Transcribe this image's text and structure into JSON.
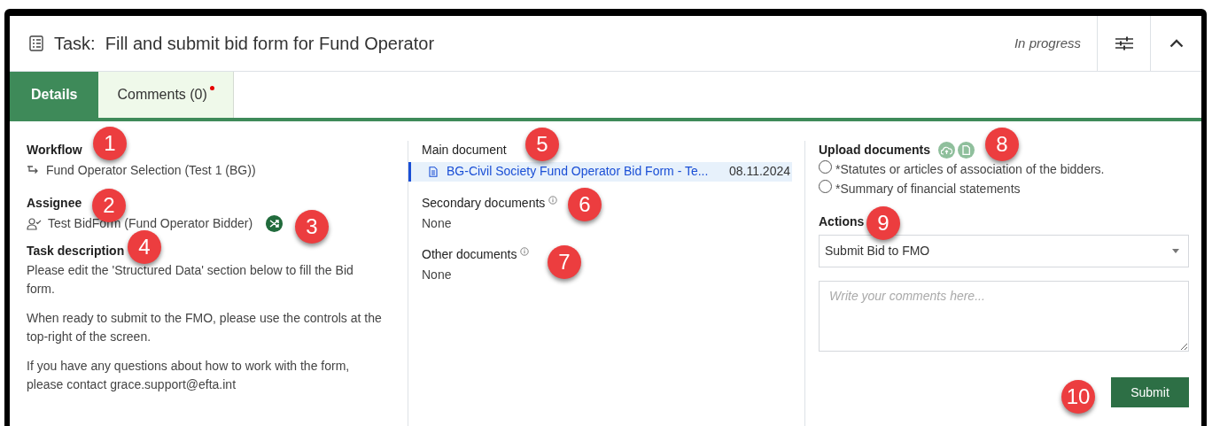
{
  "header": {
    "title_prefix": "Task:",
    "title": "Fill and submit bid form for Fund Operator",
    "status": "In progress"
  },
  "tabs": [
    {
      "label": "Details",
      "selected": true,
      "dot": false
    },
    {
      "label": "Comments (0)",
      "selected": false,
      "dot": true
    }
  ],
  "workflow": {
    "label": "Workflow",
    "value": "Fund Operator Selection (Test 1 (BG))"
  },
  "assignee": {
    "label": "Assignee",
    "value": "Test BidForm (Fund Operator Bidder)"
  },
  "description": {
    "label": "Task description",
    "paragraphs": [
      "Please edit the 'Structured Data' section below to fill the Bid form.",
      "When ready to submit to the FMO, please use the controls at the top-right of the screen.",
      "If you have any questions about how to work with the form, please contact grace.support@efta.int"
    ]
  },
  "main_document": {
    "label": "Main document",
    "name": "BG-Civil Society Fund Operator Bid Form - Te...",
    "date": "08.11.2024"
  },
  "secondary_documents": {
    "label": "Secondary documents",
    "value": "None"
  },
  "other_documents": {
    "label": "Other documents",
    "value": "None"
  },
  "upload": {
    "label": "Upload documents",
    "items": [
      {
        "label": "*Statutes or articles of association of the bidders.",
        "checked": false
      },
      {
        "label": "*Summary of financial statements",
        "checked": false
      }
    ]
  },
  "actions": {
    "label": "Actions",
    "value": "Submit Bid to FMO",
    "comment_placeholder": "Write your comments here...",
    "submit": "Submit"
  },
  "callouts": [
    "1",
    "2",
    "3",
    "4",
    "5",
    "6",
    "7",
    "8",
    "9",
    "10"
  ]
}
